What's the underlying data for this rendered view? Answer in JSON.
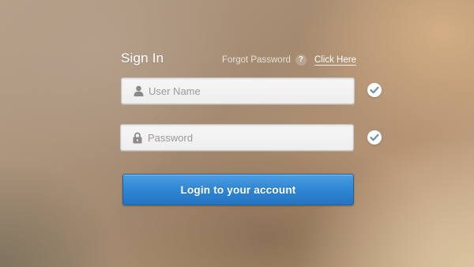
{
  "form": {
    "title": "Sign In",
    "forgot_label": "Forgot Password",
    "help_glyph": "?",
    "click_here_label": "Click Here",
    "username": {
      "value": "",
      "placeholder": "User Name",
      "icon": "user-icon",
      "validated": true
    },
    "password": {
      "value": "",
      "placeholder": "Password",
      "icon": "lock-icon",
      "validated": true
    },
    "submit_label": "Login to your account"
  },
  "colors": {
    "button_blue": "#2f86d3",
    "check_blue": "#6d8fb4",
    "field_bg": "#f2f2f2",
    "icon_gray": "#8a8a8a"
  }
}
